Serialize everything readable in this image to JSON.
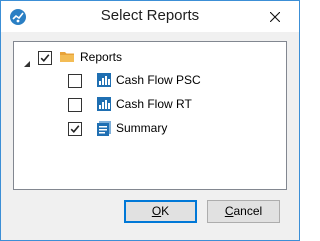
{
  "window": {
    "title": "Select Reports",
    "app_icon": "chart-app-icon",
    "close_icon": "close-icon"
  },
  "tree": {
    "root": {
      "label": "Reports",
      "checked": true,
      "expanded": true,
      "icon": "folder-icon",
      "icon_color": "#e8a33a"
    },
    "children": [
      {
        "label": "Cash Flow PSC",
        "checked": false,
        "icon": "report-chart-icon"
      },
      {
        "label": "Cash Flow RT",
        "checked": false,
        "icon": "report-chart-icon"
      },
      {
        "label": "Summary",
        "checked": true,
        "icon": "report-summary-icon"
      }
    ]
  },
  "buttons": {
    "ok": {
      "label": "OK",
      "accel": "O"
    },
    "cancel": {
      "label": "Cancel",
      "accel": "C"
    }
  },
  "colors": {
    "accent": "#0078d7",
    "window_border": "#3c8fd6",
    "report_icon_blue": "#1f6fb2"
  }
}
